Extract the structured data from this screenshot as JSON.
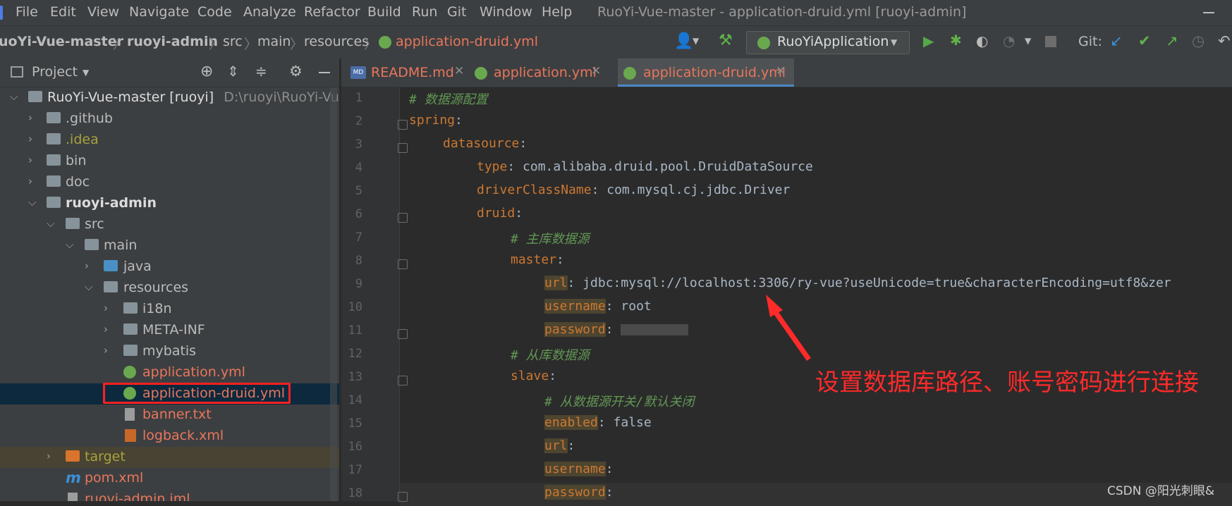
{
  "menu": [
    "File",
    "Edit",
    "View",
    "Navigate",
    "Code",
    "Analyze",
    "Refactor",
    "Build",
    "Run",
    "Git",
    "Window",
    "Help"
  ],
  "window_title": "RuoYi-Vue-master - application-druid.yml [ruoyi-admin]",
  "breadcrumb": [
    "uoYi-Vue-master",
    "ruoyi-admin",
    "src",
    "main",
    "resources",
    "application-druid.yml"
  ],
  "run_config": "RuoYiApplication",
  "git_label": "Git:",
  "project_panel": {
    "title": "Project"
  },
  "tree": [
    {
      "label": "RuoYi-Vue-master [ruoyi]",
      "extra": "D:\\ruoyi\\RuoYi-Vue-m"
    },
    {
      "label": ".github"
    },
    {
      "label": ".idea"
    },
    {
      "label": "bin"
    },
    {
      "label": "doc"
    },
    {
      "label": "ruoyi-admin"
    },
    {
      "label": "src"
    },
    {
      "label": "main"
    },
    {
      "label": "java"
    },
    {
      "label": "resources"
    },
    {
      "label": "i18n"
    },
    {
      "label": "META-INF"
    },
    {
      "label": "mybatis"
    },
    {
      "label": "application.yml"
    },
    {
      "label": "application-druid.yml"
    },
    {
      "label": "banner.txt"
    },
    {
      "label": "logback.xml"
    },
    {
      "label": "target"
    },
    {
      "label": "pom.xml"
    },
    {
      "label": "ruoyi-admin.iml"
    }
  ],
  "tabs": [
    {
      "label": "README.md"
    },
    {
      "label": "application.yml"
    },
    {
      "label": "application-druid.yml"
    }
  ],
  "code": [
    {
      "n": "1",
      "comment": "# 数据源配置"
    },
    {
      "n": "2",
      "key": "spring",
      "sep": ":"
    },
    {
      "n": "3",
      "key": "datasource",
      "sep": ":"
    },
    {
      "n": "4",
      "key": "type",
      "sep": ": ",
      "value": "com.alibaba.druid.pool.DruidDataSource"
    },
    {
      "n": "5",
      "key": "driverClassName",
      "sep": ": ",
      "value": "com.mysql.cj.jdbc.Driver"
    },
    {
      "n": "6",
      "key": "druid",
      "sep": ":"
    },
    {
      "n": "7",
      "comment": "# 主库数据源"
    },
    {
      "n": "8",
      "key": "master",
      "sep": ":"
    },
    {
      "n": "9",
      "key": "url",
      "sep": ": ",
      "value": "jdbc:mysql://localhost:3306/ry-vue?useUnicode=true&characterEncoding=utf8&zer"
    },
    {
      "n": "10",
      "key": "username",
      "sep": ": ",
      "value": "root"
    },
    {
      "n": "11",
      "key": "password",
      "sep": ":"
    },
    {
      "n": "12",
      "comment": "# 从库数据源"
    },
    {
      "n": "13",
      "key": "slave",
      "sep": ":"
    },
    {
      "n": "14",
      "comment": "# 从数据源开关/默认关闭"
    },
    {
      "n": "15",
      "key": "enabled",
      "sep": ": ",
      "value": "false"
    },
    {
      "n": "16",
      "key": "url",
      "sep": ":"
    },
    {
      "n": "17",
      "key": "username",
      "sep": ":"
    },
    {
      "n": "18",
      "key": "password",
      "sep": ":"
    }
  ],
  "annotation": "设置数据库路径、账号密码进行连接",
  "watermark": "CSDN @阳光刺眼&",
  "colors": {
    "annotation": "#ff2a2a",
    "key": "#cc7832",
    "comment": "#629755",
    "selection": "#0d293e"
  }
}
